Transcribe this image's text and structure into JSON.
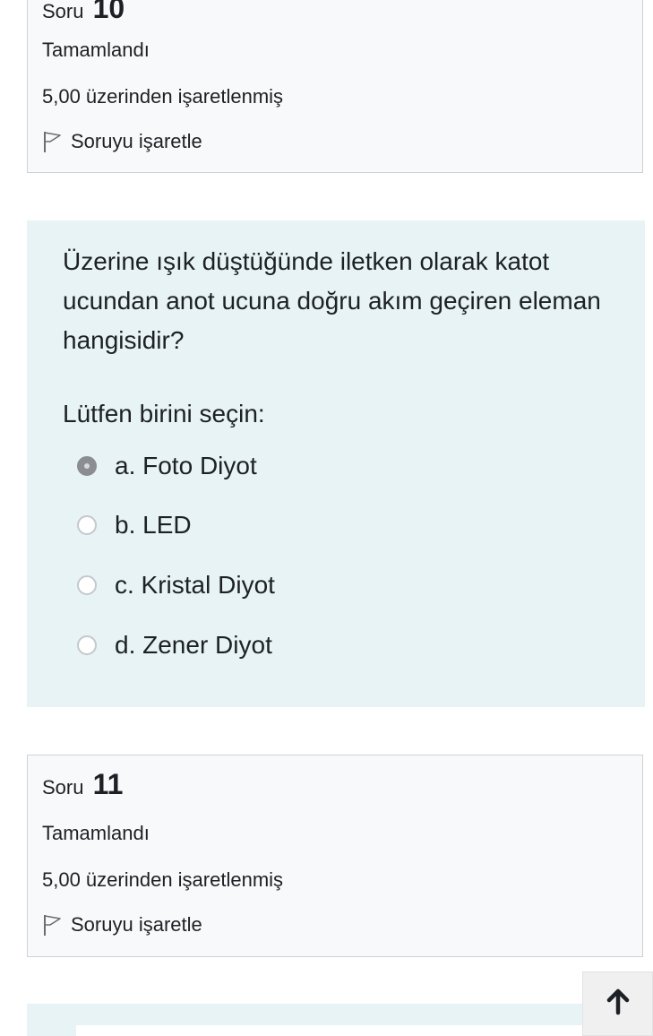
{
  "question10": {
    "label": "Soru",
    "number": "10",
    "state": "Tamamlandı",
    "grade": "5,00 üzerinden işaretlenmiş",
    "flag_label": "Soruyu işaretle"
  },
  "question_text": "Üzerine ışık düştüğünde iletken olarak katot ucundan anot ucuna doğru akım geçiren eleman hangisidir?",
  "prompt": "Lütfen birini seçin:",
  "answers": [
    {
      "label": "a. Foto Diyot",
      "selected": true
    },
    {
      "label": "b. LED",
      "selected": false
    },
    {
      "label": "c. Kristal Diyot",
      "selected": false
    },
    {
      "label": "d. Zener Diyot",
      "selected": false
    }
  ],
  "question11": {
    "label": "Soru",
    "number": "11",
    "state": "Tamamlandı",
    "grade": "5,00 üzerinden işaretlenmiş",
    "flag_label": "Soruyu işaretle"
  },
  "icons": {
    "flag": "flag-icon",
    "back_to_top": "arrow-up-icon"
  },
  "colors": {
    "formulation_bg": "#e7f3f5",
    "info_bg": "#f8f9fa",
    "text": "#1d2125"
  }
}
